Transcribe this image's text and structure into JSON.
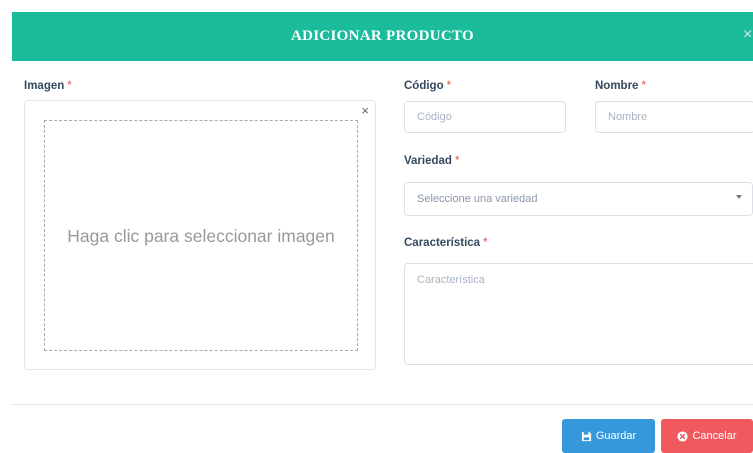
{
  "header": {
    "title": "ADICIONAR PRODUCTO",
    "close_label": "×"
  },
  "required_mark": "*",
  "image": {
    "label": "Imagen",
    "remove_label": "×",
    "hint": "Haga clic para seleccionar imagen"
  },
  "codigo": {
    "label": "Código",
    "placeholder": "Código"
  },
  "nombre": {
    "label": "Nombre",
    "placeholder": "Nombre"
  },
  "variedad": {
    "label": "Variedad",
    "selected": "Seleccione una variedad"
  },
  "caracteristica": {
    "label": "Característica",
    "placeholder": "Característica"
  },
  "buttons": {
    "save_label": "Guardar",
    "cancel_label": "Cancelar"
  },
  "colors": {
    "header": "#1abc9c",
    "required": "#e74c3c",
    "save": "#3498db",
    "cancel": "#f05a5f"
  },
  "icons": {
    "save": "floppy-disk-icon",
    "cancel": "times-circle-icon"
  }
}
